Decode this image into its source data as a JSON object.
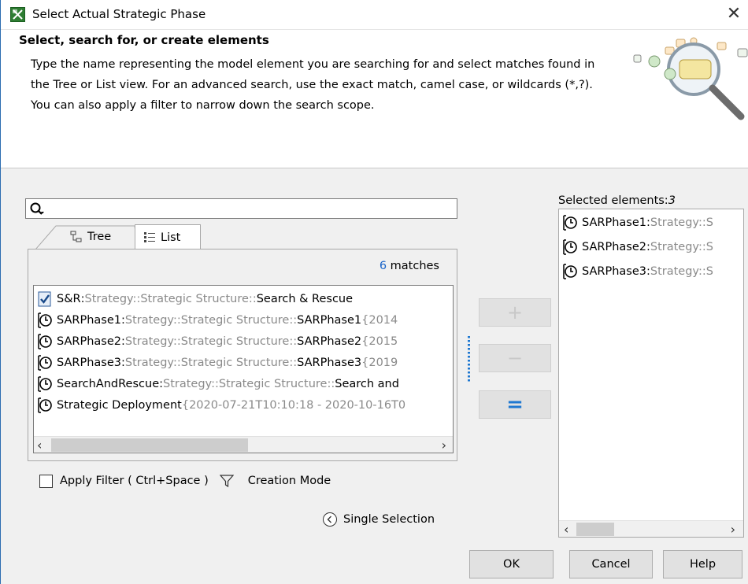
{
  "window": {
    "title": "Select Actual Strategic Phase",
    "close_glyph": "✕"
  },
  "header": {
    "title": "Select, search for, or create elements",
    "description": "Type the name representing the model element you are searching for and select matches found in the Tree or List view. For an advanced search, use the exact match, camel case, or wildcards (*,?). You can also apply a filter to narrow down the search scope."
  },
  "search": {
    "value": "",
    "placeholder": ""
  },
  "tabs": [
    {
      "label": "Tree",
      "icon": "tree-icon",
      "active": false
    },
    {
      "label": "List",
      "icon": "list-icon",
      "active": true
    }
  ],
  "matches": {
    "count": "6",
    "suffix": " matches"
  },
  "list_items": [
    {
      "icon": "checked-document-icon",
      "name": "S&R",
      "sep": " : ",
      "path": "Strategy::Strategic Structure::",
      "target": "Search & Rescue",
      "extra": ""
    },
    {
      "icon": "strategic-phase-icon",
      "name": "SARPhase1",
      "sep": " : ",
      "path": "Strategy::Strategic Structure::",
      "target": "SARPhase1",
      "extra": " {2014"
    },
    {
      "icon": "strategic-phase-icon",
      "name": "SARPhase2",
      "sep": " : ",
      "path": "Strategy::Strategic Structure::",
      "target": "SARPhase2",
      "extra": " {2015"
    },
    {
      "icon": "strategic-phase-icon",
      "name": "SARPhase3",
      "sep": " : ",
      "path": "Strategy::Strategic Structure::",
      "target": "SARPhase3",
      "extra": " {2019"
    },
    {
      "icon": "strategic-phase-icon",
      "name": "SearchAndRescue",
      "sep": " : ",
      "path": "Strategy::Strategic Structure::",
      "target": "Search and",
      "extra": ""
    },
    {
      "icon": "strategic-phase-icon",
      "name": "Strategic Deployment",
      "sep": "",
      "path": " {2020-07-21T10:10:18 - 2020-10-16T0",
      "target": "",
      "extra": ""
    }
  ],
  "scroll": {
    "left": "‹",
    "right": "›"
  },
  "filter": {
    "checked": false,
    "label": "Apply Filter ( Ctrl+Space )",
    "creation_mode": "Creation Mode"
  },
  "single_selection": "Single Selection",
  "ops": {
    "add": "+",
    "remove": "−",
    "equal": "="
  },
  "selected": {
    "label": "Selected elements:",
    "count": "3",
    "items": [
      {
        "name": "SARPhase1",
        "sep": " : ",
        "path": "Strategy::S"
      },
      {
        "name": "SARPhase2",
        "sep": " : ",
        "path": "Strategy::S"
      },
      {
        "name": "SARPhase3",
        "sep": " : ",
        "path": "Strategy::S"
      }
    ]
  },
  "buttons": {
    "ok": "OK",
    "cancel": "Cancel",
    "help": "Help"
  },
  "colors": {
    "accent_blue": "#1a64c8",
    "disabled_gray": "#8a8a8a"
  }
}
